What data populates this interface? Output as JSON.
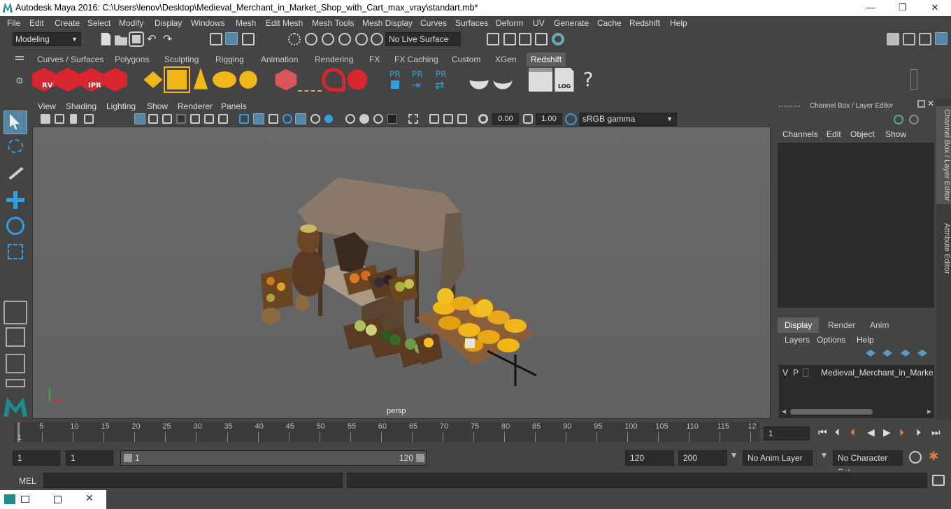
{
  "window": {
    "title": "Autodesk Maya 2016: C:\\Users\\lenov\\Desktop\\Medieval_Merchant_in_Market_Shop_with_Cart_max_vray\\standart.mb*",
    "minimize": "—",
    "maximize": "❐",
    "close": "✕"
  },
  "menu": [
    "File",
    "Edit",
    "Create",
    "Select",
    "Modify",
    "Display",
    "Windows",
    "Mesh",
    "Edit Mesh",
    "Mesh Tools",
    "Mesh Display",
    "Curves",
    "Surfaces",
    "Deform",
    "UV",
    "Generate",
    "Cache",
    "Redshift",
    "Help"
  ],
  "status": {
    "mode": "Modeling",
    "live_surface": "No Live Surface"
  },
  "shelf_tabs": [
    "Curves / Surfaces",
    "Polygons",
    "Sculpting",
    "Rigging",
    "Animation",
    "Rendering",
    "FX",
    "FX Caching",
    "Custom",
    "XGen",
    "Redshift"
  ],
  "shelf_active": "Redshift",
  "shelf_icons": {
    "rv": "RV",
    "ipr": "IPR",
    "pr": "PR",
    "log": "LOG",
    "help": "?"
  },
  "viewport": {
    "menu": [
      "View",
      "Shading",
      "Lighting",
      "Show",
      "Renderer",
      "Panels"
    ],
    "exposure": "0.00",
    "gamma": "1.00",
    "color_space": "sRGB gamma",
    "camera": "persp"
  },
  "channel_box": {
    "header": "Channel Box / Layer Editor",
    "menu": [
      "Channels",
      "Edit",
      "Object",
      "Show"
    ],
    "layer_tabs": [
      "Display",
      "Render",
      "Anim"
    ],
    "layer_menu": [
      "Layers",
      "Options",
      "Help"
    ],
    "layer_row": {
      "v": "V",
      "p": "P",
      "name": "Medieval_Merchant_in_Market_"
    }
  },
  "side_tabs": [
    "Channel Box / Layer Editor",
    "Attribute Editor"
  ],
  "timeline": {
    "ticks": [
      "5",
      "10",
      "15",
      "20",
      "25",
      "30",
      "35",
      "40",
      "45",
      "50",
      "55",
      "60",
      "65",
      "70",
      "75",
      "80",
      "85",
      "90",
      "95",
      "100",
      "105",
      "110",
      "115",
      "12"
    ],
    "start_label": "1",
    "current_frame": "1"
  },
  "range": {
    "start": "1",
    "playback_start": "1",
    "slider_start": "1",
    "slider_end": "120",
    "playback_end": "120",
    "end": "200",
    "anim_layer": "No Anim Layer",
    "char_set": "No Character Set"
  },
  "command": {
    "label": "MEL"
  },
  "colors": {
    "accent": "#5285a6",
    "redshift_red": "#d9262e",
    "yellow": "#f2b619"
  }
}
